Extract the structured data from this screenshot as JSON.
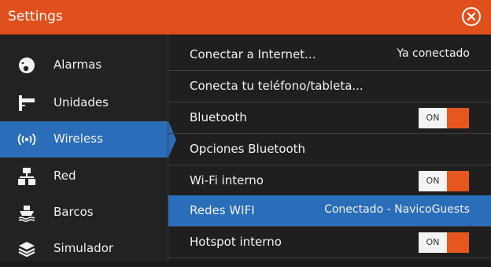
{
  "header": {
    "title": "Settings"
  },
  "sidebar": {
    "items": [
      {
        "label": "Alarmas",
        "icon": "alarm-icon"
      },
      {
        "label": "Unidades",
        "icon": "units-icon"
      },
      {
        "label": "Wireless",
        "icon": "wireless-icon",
        "active": true
      },
      {
        "label": "Red",
        "icon": "network-icon"
      },
      {
        "label": "Barcos",
        "icon": "boats-icon"
      },
      {
        "label": "Simulador",
        "icon": "simulator-icon"
      }
    ]
  },
  "wireless": {
    "rows": [
      {
        "label": "Conectar a Internet...",
        "value": "Ya conectado"
      },
      {
        "label": "Conecta tu teléfono/tableta..."
      },
      {
        "label": "Bluetooth",
        "toggle": "ON"
      },
      {
        "label": "Opciones Bluetooth"
      },
      {
        "label": "Wi-Fi interno",
        "toggle": "ON"
      },
      {
        "label": "Redes WIFI",
        "value": "Conectado - NavicoGuests",
        "active": true
      },
      {
        "label": "Hotspot interno",
        "toggle": "ON"
      }
    ]
  },
  "colors": {
    "accent": "#e0501c",
    "selection": "#2a6db8",
    "toggle_on": "#e8561f"
  }
}
